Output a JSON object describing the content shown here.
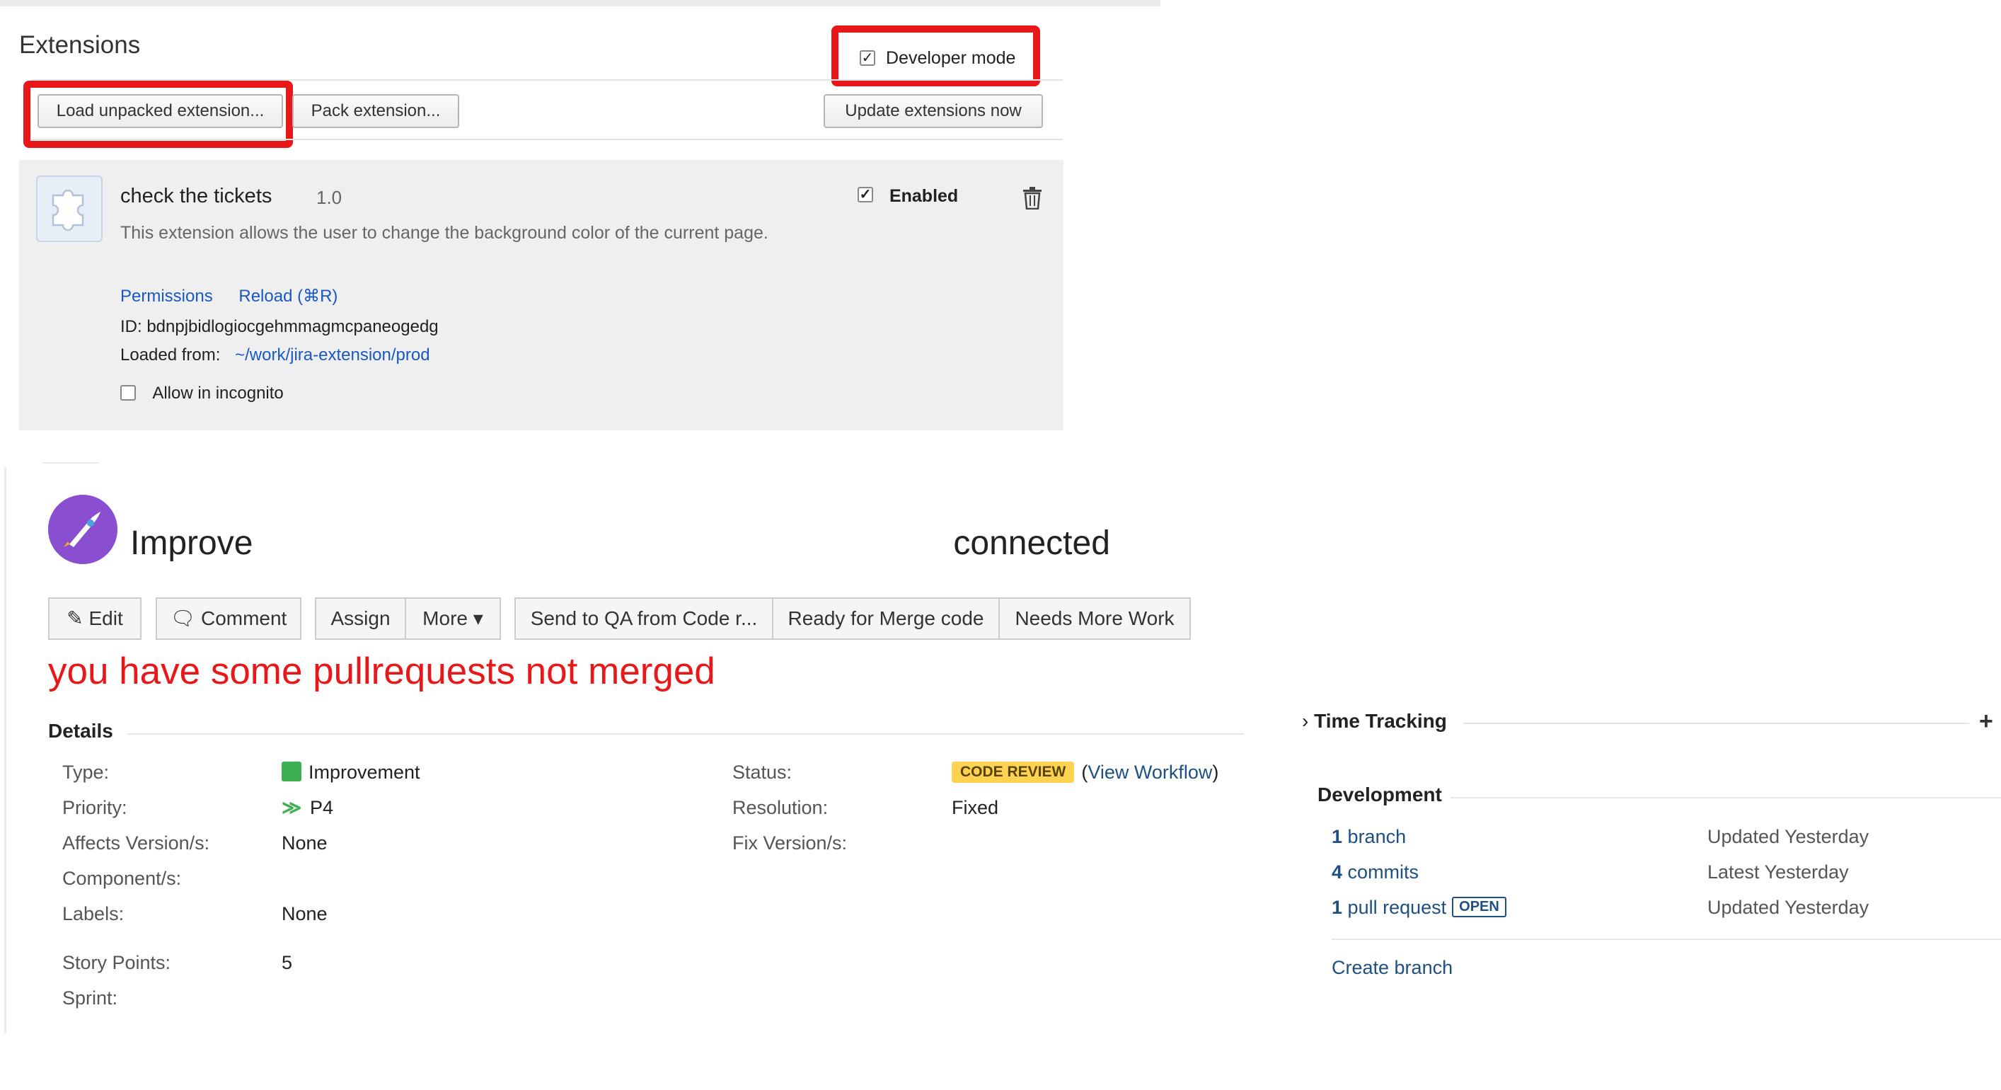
{
  "extensions": {
    "title": "Extensions",
    "developer_mode_label": "Developer mode",
    "buttons": {
      "load_unpacked": "Load unpacked extension...",
      "pack": "Pack extension...",
      "update": "Update extensions now"
    },
    "item": {
      "name": "check the tickets",
      "version": "1.0",
      "description": "This extension allows the user to change the background color of the current page.",
      "links": {
        "permissions": "Permissions",
        "reload": "Reload (⌘R)"
      },
      "id_text": "ID: bdnpjbidlogiocgehmmagmcpaneogedg",
      "loaded_from_label": "Loaded from:",
      "loaded_from_path": "~/work/jira-extension/prod",
      "incognito_label": "Allow in incognito",
      "enabled_label": "Enabled"
    }
  },
  "jira": {
    "title_start": "Improve",
    "title_end": "connected",
    "buttons": {
      "edit": "Edit",
      "comment": "Comment",
      "assign": "Assign",
      "more": "More",
      "send_to_qa": "Send to QA from Code r...",
      "ready_merge": "Ready for Merge code",
      "needs_work": "Needs More Work"
    },
    "warning": "you have some pullrequests not merged",
    "details": {
      "heading": "Details",
      "type_label": "Type:",
      "type_value": "Improvement",
      "priority_label": "Priority:",
      "priority_value": "P4",
      "affects_label": "Affects Version/s:",
      "affects_value": "None",
      "components_label": "Component/s:",
      "labels_label": "Labels:",
      "labels_value": "None",
      "story_points_label": "Story Points:",
      "story_points_value": "5",
      "sprint_label": "Sprint:",
      "status_label": "Status:",
      "status_value": "CODE REVIEW",
      "view_workflow": "View Workflow",
      "resolution_label": "Resolution:",
      "resolution_value": "Fixed",
      "fix_label": "Fix Version/s:"
    },
    "sidebar": {
      "time_tracking": "Time Tracking",
      "development": "Development",
      "branch": {
        "count": "1",
        "label": "branch",
        "status": "Updated Yesterday"
      },
      "commits": {
        "count": "4",
        "label": "commits",
        "status": "Latest Yesterday"
      },
      "pull_request": {
        "count": "1",
        "label": "pull request",
        "badge": "OPEN",
        "status": "Updated Yesterday"
      },
      "create_branch": "Create branch"
    }
  },
  "colors": {
    "highlight": "#e8181a",
    "link": "#205081",
    "chrome_link": "#1a58c4"
  }
}
